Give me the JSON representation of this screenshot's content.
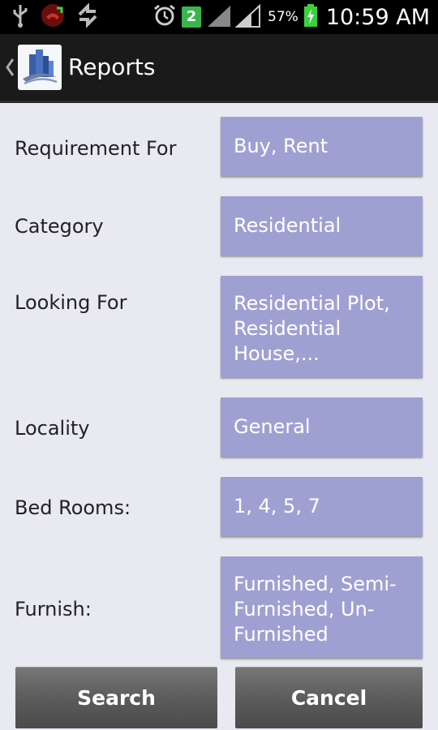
{
  "status_bar": {
    "notification_count": "2",
    "battery_percent": "57%",
    "time": "10:59 AM",
    "icons": [
      "usb-icon",
      "missed-call-icon",
      "sync-icon",
      "alarm-icon",
      "signal-icon",
      "battery-charging-icon"
    ]
  },
  "action_bar": {
    "title": "Reports",
    "icons": [
      "back-chevron-icon",
      "app-logo-icon"
    ]
  },
  "form": {
    "rows": [
      {
        "label": "Requirement For",
        "value": "Buy, Rent"
      },
      {
        "label": "Category",
        "value": "Residential"
      },
      {
        "label": "Looking For",
        "value": "Residential Plot, Residential House,..."
      },
      {
        "label": "Locality",
        "value": "General"
      },
      {
        "label": "Bed Rooms:",
        "value": "1, 4, 5, 7"
      },
      {
        "label": "Furnish:",
        "value": "Furnished, Semi-Furnished, Un-Furnished"
      }
    ]
  },
  "buttons": {
    "search": "Search",
    "cancel": "Cancel"
  },
  "colors": {
    "field_background": "#9fa0d2",
    "page_background": "#e9e9f1",
    "button": "#5a5a5a",
    "action_bar": "#1a1a1a"
  }
}
